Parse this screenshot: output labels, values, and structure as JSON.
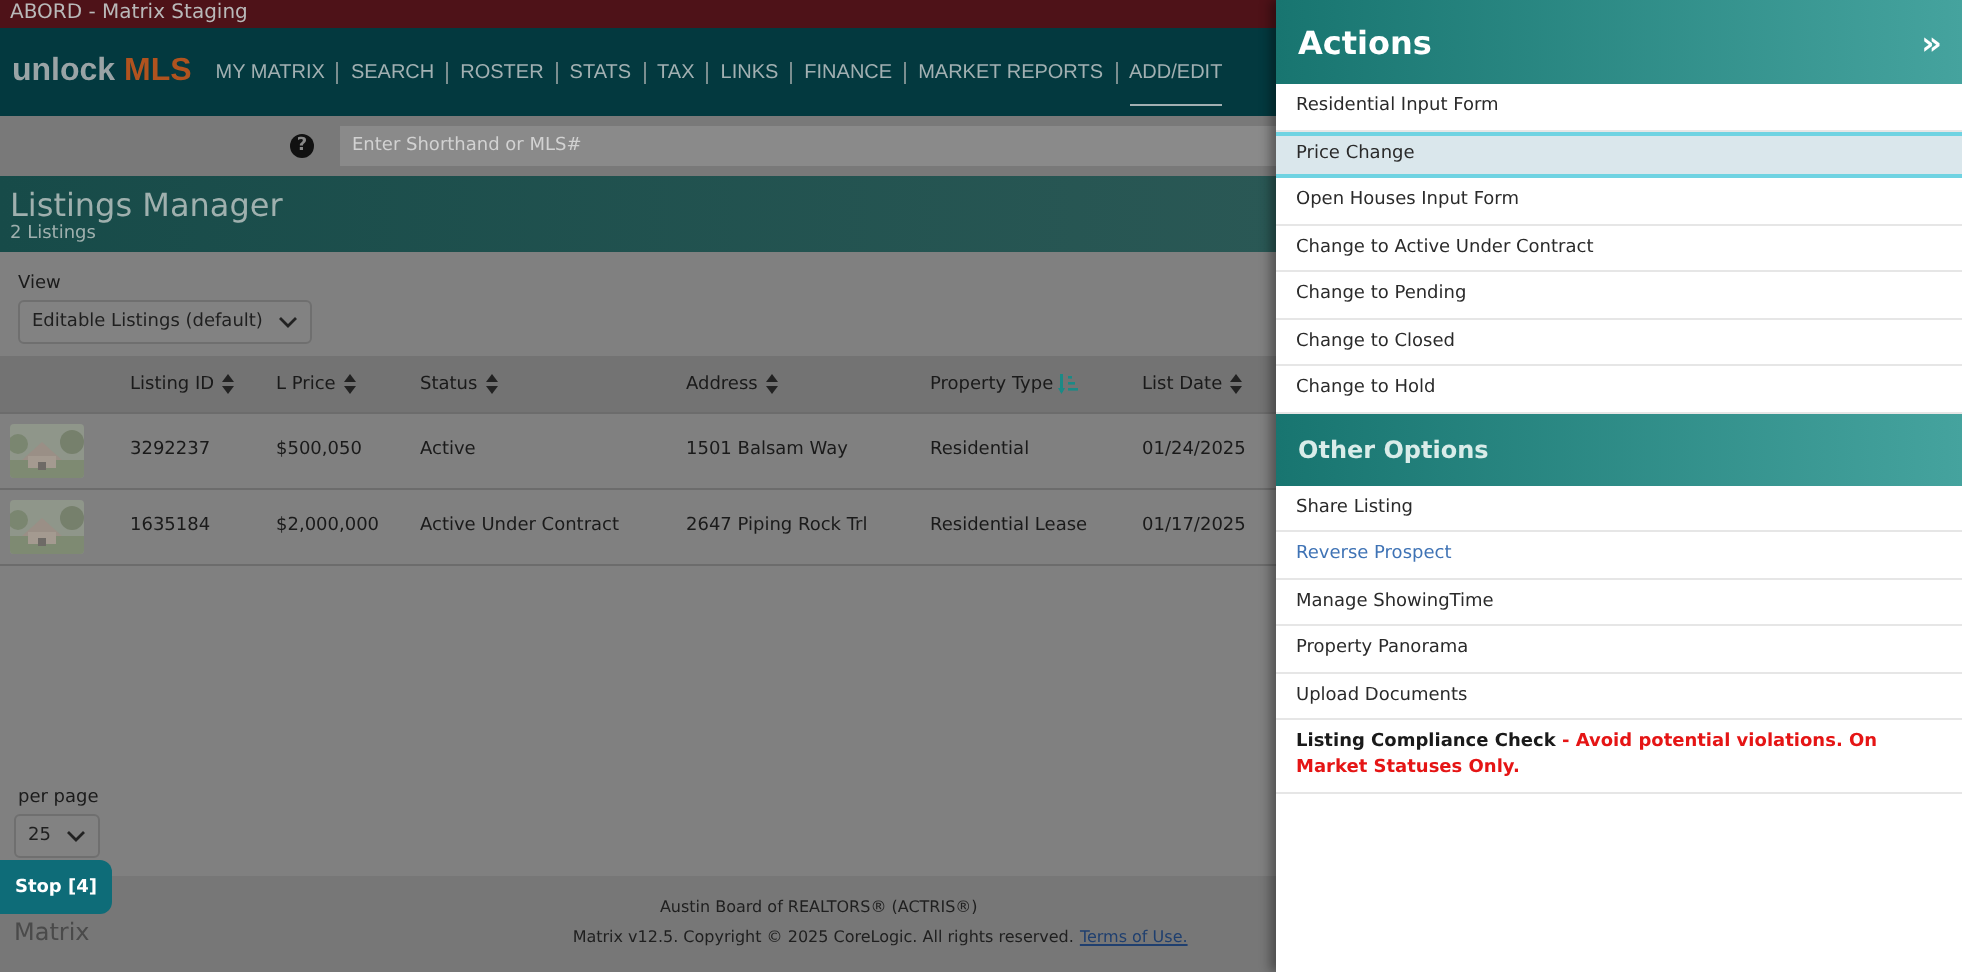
{
  "window": {
    "title": "ABORD - Matrix Staging"
  },
  "nav": {
    "logo": {
      "word": "unlock",
      "accent": "MLS"
    },
    "items": [
      {
        "label": "MY MATRIX",
        "selected": false
      },
      {
        "label": "SEARCH",
        "selected": false
      },
      {
        "label": "ROSTER",
        "selected": false
      },
      {
        "label": "STATS",
        "selected": false
      },
      {
        "label": "TAX",
        "selected": false
      },
      {
        "label": "LINKS",
        "selected": false
      },
      {
        "label": "FINANCE",
        "selected": false
      },
      {
        "label": "MARKET REPORTS",
        "selected": false
      },
      {
        "label": "ADD/EDIT",
        "selected": true
      }
    ]
  },
  "search": {
    "help": "?",
    "placeholder": "Enter Shorthand or MLS#"
  },
  "page": {
    "title": "Listings Manager",
    "subtitle": "2 Listings"
  },
  "view": {
    "label": "View",
    "value": "Editable Listings (default)"
  },
  "table": {
    "columns": [
      {
        "label": "Listing ID",
        "sorted": false
      },
      {
        "label": "L Price",
        "sorted": false
      },
      {
        "label": "Status",
        "sorted": false
      },
      {
        "label": "Address",
        "sorted": false
      },
      {
        "label": "Property Type",
        "sorted": true
      },
      {
        "label": "List Date",
        "sorted": false
      }
    ],
    "rows": [
      {
        "photo": {
          "kind": "picture"
        },
        "cells": [
          "3292237",
          "$500,050",
          "Active",
          "1501 Balsam Way",
          "Residential",
          "01/24/2025"
        ]
      },
      {
        "photo": {
          "kind": "picture"
        },
        "cells": [
          "1635184",
          "$2,000,000",
          "Active Under Contract",
          "2647 Piping Rock Trl",
          "Residential Lease",
          "01/17/2025"
        ]
      }
    ]
  },
  "per_page": {
    "label": "per page",
    "value": "25"
  },
  "stop_button": {
    "label": "Stop [4]"
  },
  "footer": {
    "logo": "Matrix",
    "org": "Austin Board of REALTORS® (ACTRIS®)",
    "copyright": "Matrix v12.5. Copyright © 2025 CoreLogic. All rights reserved.",
    "link": "Terms of Use."
  },
  "actions": {
    "title": "Actions",
    "collapse": "»",
    "items": [
      {
        "kind": "item",
        "label": "Residential Input Form",
        "selected": false
      },
      {
        "kind": "item",
        "label": "Price Change",
        "selected": true
      },
      {
        "kind": "item",
        "label": "Open Houses Input Form",
        "selected": false
      },
      {
        "kind": "item",
        "label": "Change to Active Under Contract",
        "selected": false
      },
      {
        "kind": "item",
        "label": "Change to Pending",
        "selected": false
      },
      {
        "kind": "item",
        "label": "Change to Closed",
        "selected": false
      },
      {
        "kind": "item",
        "label": "Change to Hold",
        "selected": false
      }
    ]
  },
  "other_options": {
    "title": "Other Options",
    "items": [
      {
        "kind": "item",
        "label": "Share Listing",
        "selected": false
      },
      {
        "kind": "link",
        "label": "Reverse Prospect",
        "selected": false
      },
      {
        "kind": "item",
        "label": "Manage ShowingTime",
        "selected": false
      },
      {
        "kind": "item",
        "label": "Property Panorama",
        "selected": false
      },
      {
        "kind": "item",
        "label": "Upload Documents",
        "selected": false
      },
      {
        "kind": "notice",
        "label": "Listing Compliance Check",
        "note": "- Avoid potential violations. On Market Statuses Only.",
        "selected": false
      }
    ]
  }
}
